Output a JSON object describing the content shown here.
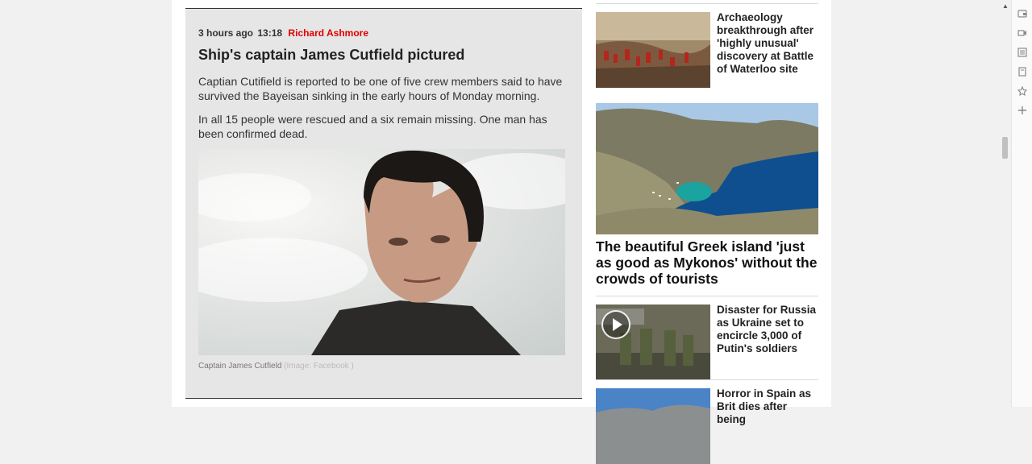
{
  "liveblog": {
    "time_ago": "3 hours ago",
    "time": "13:18",
    "author": "Richard Ashmore",
    "title": "Ship's captain James Cutfield pictured",
    "paragraphs": [
      "Captian Cutifield is reported to be one of five crew members said to have survived the Bayeisan sinking in the early hours of Monday morning.",
      "In all 15 people were rescued and a six remain missing. One man has been confirmed dead."
    ],
    "caption": "Captain James Cutfield",
    "credit": "(Image: Facebook )"
  },
  "sidebar": {
    "stories": [
      {
        "title": "Archaeology breakthrough after 'highly unusual' discovery at Battle of Waterloo site"
      },
      {
        "title": "The beautiful Greek island 'just as good as Mykonos' without the crowds of tourists"
      },
      {
        "title": "Disaster for Russia as Ukraine set to encircle 3,000 of Putin's soldiers"
      },
      {
        "title": "Horror in Spain as Brit dies after being"
      }
    ]
  },
  "toolbar_icons": [
    "wallet-icon",
    "video-icon",
    "reader-icon",
    "save-icon",
    "favorite-icon",
    "add-icon"
  ]
}
